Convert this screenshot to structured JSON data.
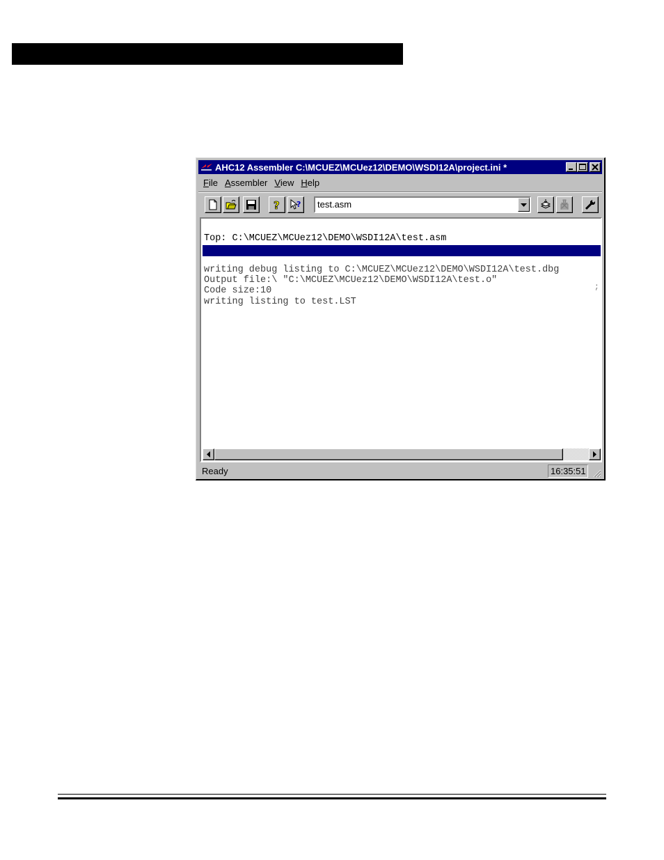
{
  "window": {
    "title": "AHC12 Assembler  C:\\MCUEZ\\MCUez12\\DEMO\\WSDI12A\\project.ini *"
  },
  "menu": [
    {
      "key": "F",
      "rest": "ile"
    },
    {
      "key": "A",
      "rest": "ssembler"
    },
    {
      "key": "V",
      "rest": "iew"
    },
    {
      "key": "H",
      "rest": "elp"
    }
  ],
  "toolbar": {
    "file_combo_value": "test.asm"
  },
  "output": {
    "top_line": "Top: C:\\MCUEZ\\MCUez12\\DEMO\\WSDI12A\\test.asm",
    "log": [
      "writing debug listing to C:\\MCUEZ\\MCUez12\\DEMO\\WSDI12A\\test.dbg",
      "Output file:\\ \"C:\\MCUEZ\\MCUez12\\DEMO\\WSDI12A\\test.o\"",
      "Code size:10",
      "writing listing to test.LST"
    ],
    "trunc_marker": ";"
  },
  "status": {
    "text": "Ready",
    "time": "16:35:51"
  },
  "icons": {
    "app": "assembler-app-icon",
    "new": "new-file-icon",
    "open": "open-folder-icon",
    "save": "save-disk-icon",
    "help": "help-icon",
    "context_help": "context-help-icon",
    "assemble": "assemble-icon",
    "stop": "stop-icon",
    "options": "wrench-icon"
  },
  "colors": {
    "titlebar": "#000080",
    "face": "#c0c0c0",
    "highlight_row": "#000080"
  }
}
